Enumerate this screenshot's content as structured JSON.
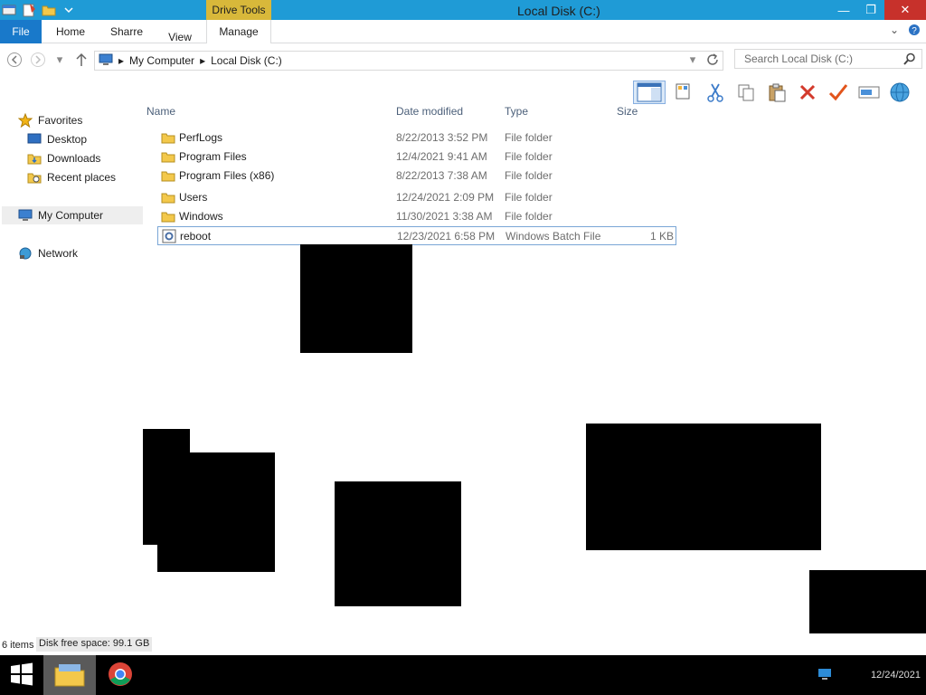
{
  "window": {
    "title": "Local Disk (C:)",
    "context_tab_group": "Drive Tools",
    "controls": {
      "minimize": "—",
      "restore": "❐",
      "close": "✕"
    }
  },
  "ribbon": {
    "tabs": [
      {
        "label": "File"
      },
      {
        "label": "Home"
      },
      {
        "label": "Sharre"
      },
      {
        "label": "View"
      },
      {
        "label": "Manage"
      }
    ]
  },
  "address": {
    "crumbs": [
      "My Computer",
      "Local Disk (C:)"
    ],
    "search_placeholder": "Search Local Disk (C:)"
  },
  "navigation": {
    "items": [
      {
        "label": "Favorites",
        "icon": "star-icon"
      },
      {
        "label": "Desktop",
        "icon": "desktop-icon"
      },
      {
        "label": "Downloads",
        "icon": "downloads-icon"
      },
      {
        "label": "Recent places",
        "icon": "recent-places-icon"
      },
      {
        "label": "My Computer",
        "icon": "computer-icon"
      },
      {
        "label": "Network",
        "icon": "network-icon"
      }
    ]
  },
  "filelist": {
    "columns": [
      "Name",
      "Date modified",
      "Type",
      "Size"
    ],
    "rows": [
      {
        "name": "PerfLogs",
        "date": "8/22/2013 3:52 PM",
        "type": "File folder",
        "size": ""
      },
      {
        "name": "Program Files",
        "date": "12/4/2021 9:41 AM",
        "type": "File folder",
        "size": ""
      },
      {
        "name": "Program Files (x86)",
        "date": "8/22/2013 7:38 AM",
        "type": "File folder",
        "size": ""
      },
      {
        "name": "Users",
        "date": "12/24/2021 2:09 PM",
        "type": "File folder",
        "size": ""
      },
      {
        "name": "Windows",
        "date": "11/30/2021 3:38 AM",
        "type": "File folder",
        "size": ""
      },
      {
        "name": "reboot",
        "date": "12/23/2021 6:58 PM",
        "type": "Windows Batch File",
        "size": "1 KB"
      }
    ]
  },
  "status": {
    "item_count": "6 items",
    "free_space": "Disk free space: 99.1 GB"
  },
  "taskbar": {
    "clock": "12/24/2021"
  },
  "colors": {
    "titlebar": "#1f9bd6",
    "file_tab": "#1979ca",
    "context_tab": "#d8b83a",
    "close_button": "#c7312b",
    "selection_border": "#7aa6d6"
  }
}
